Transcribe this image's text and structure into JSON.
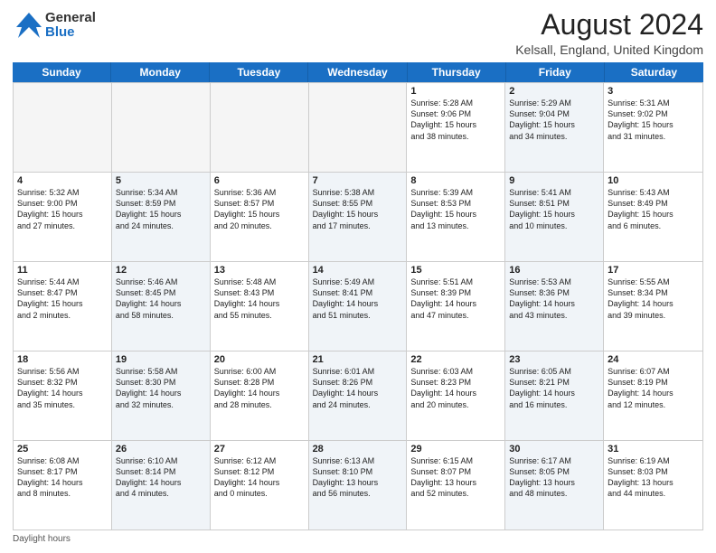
{
  "logo": {
    "general": "General",
    "blue": "Blue"
  },
  "title": "August 2024",
  "location": "Kelsall, England, United Kingdom",
  "days": [
    "Sunday",
    "Monday",
    "Tuesday",
    "Wednesday",
    "Thursday",
    "Friday",
    "Saturday"
  ],
  "rows": [
    [
      {
        "num": "",
        "lines": [],
        "shade": false,
        "empty": true
      },
      {
        "num": "",
        "lines": [],
        "shade": false,
        "empty": true
      },
      {
        "num": "",
        "lines": [],
        "shade": false,
        "empty": true
      },
      {
        "num": "",
        "lines": [],
        "shade": false,
        "empty": true
      },
      {
        "num": "1",
        "lines": [
          "Sunrise: 5:28 AM",
          "Sunset: 9:06 PM",
          "Daylight: 15 hours",
          "and 38 minutes."
        ],
        "shade": false,
        "empty": false
      },
      {
        "num": "2",
        "lines": [
          "Sunrise: 5:29 AM",
          "Sunset: 9:04 PM",
          "Daylight: 15 hours",
          "and 34 minutes."
        ],
        "shade": true,
        "empty": false
      },
      {
        "num": "3",
        "lines": [
          "Sunrise: 5:31 AM",
          "Sunset: 9:02 PM",
          "Daylight: 15 hours",
          "and 31 minutes."
        ],
        "shade": false,
        "empty": false
      }
    ],
    [
      {
        "num": "4",
        "lines": [
          "Sunrise: 5:32 AM",
          "Sunset: 9:00 PM",
          "Daylight: 15 hours",
          "and 27 minutes."
        ],
        "shade": false,
        "empty": false
      },
      {
        "num": "5",
        "lines": [
          "Sunrise: 5:34 AM",
          "Sunset: 8:59 PM",
          "Daylight: 15 hours",
          "and 24 minutes."
        ],
        "shade": true,
        "empty": false
      },
      {
        "num": "6",
        "lines": [
          "Sunrise: 5:36 AM",
          "Sunset: 8:57 PM",
          "Daylight: 15 hours",
          "and 20 minutes."
        ],
        "shade": false,
        "empty": false
      },
      {
        "num": "7",
        "lines": [
          "Sunrise: 5:38 AM",
          "Sunset: 8:55 PM",
          "Daylight: 15 hours",
          "and 17 minutes."
        ],
        "shade": true,
        "empty": false
      },
      {
        "num": "8",
        "lines": [
          "Sunrise: 5:39 AM",
          "Sunset: 8:53 PM",
          "Daylight: 15 hours",
          "and 13 minutes."
        ],
        "shade": false,
        "empty": false
      },
      {
        "num": "9",
        "lines": [
          "Sunrise: 5:41 AM",
          "Sunset: 8:51 PM",
          "Daylight: 15 hours",
          "and 10 minutes."
        ],
        "shade": true,
        "empty": false
      },
      {
        "num": "10",
        "lines": [
          "Sunrise: 5:43 AM",
          "Sunset: 8:49 PM",
          "Daylight: 15 hours",
          "and 6 minutes."
        ],
        "shade": false,
        "empty": false
      }
    ],
    [
      {
        "num": "11",
        "lines": [
          "Sunrise: 5:44 AM",
          "Sunset: 8:47 PM",
          "Daylight: 15 hours",
          "and 2 minutes."
        ],
        "shade": false,
        "empty": false
      },
      {
        "num": "12",
        "lines": [
          "Sunrise: 5:46 AM",
          "Sunset: 8:45 PM",
          "Daylight: 14 hours",
          "and 58 minutes."
        ],
        "shade": true,
        "empty": false
      },
      {
        "num": "13",
        "lines": [
          "Sunrise: 5:48 AM",
          "Sunset: 8:43 PM",
          "Daylight: 14 hours",
          "and 55 minutes."
        ],
        "shade": false,
        "empty": false
      },
      {
        "num": "14",
        "lines": [
          "Sunrise: 5:49 AM",
          "Sunset: 8:41 PM",
          "Daylight: 14 hours",
          "and 51 minutes."
        ],
        "shade": true,
        "empty": false
      },
      {
        "num": "15",
        "lines": [
          "Sunrise: 5:51 AM",
          "Sunset: 8:39 PM",
          "Daylight: 14 hours",
          "and 47 minutes."
        ],
        "shade": false,
        "empty": false
      },
      {
        "num": "16",
        "lines": [
          "Sunrise: 5:53 AM",
          "Sunset: 8:36 PM",
          "Daylight: 14 hours",
          "and 43 minutes."
        ],
        "shade": true,
        "empty": false
      },
      {
        "num": "17",
        "lines": [
          "Sunrise: 5:55 AM",
          "Sunset: 8:34 PM",
          "Daylight: 14 hours",
          "and 39 minutes."
        ],
        "shade": false,
        "empty": false
      }
    ],
    [
      {
        "num": "18",
        "lines": [
          "Sunrise: 5:56 AM",
          "Sunset: 8:32 PM",
          "Daylight: 14 hours",
          "and 35 minutes."
        ],
        "shade": false,
        "empty": false
      },
      {
        "num": "19",
        "lines": [
          "Sunrise: 5:58 AM",
          "Sunset: 8:30 PM",
          "Daylight: 14 hours",
          "and 32 minutes."
        ],
        "shade": true,
        "empty": false
      },
      {
        "num": "20",
        "lines": [
          "Sunrise: 6:00 AM",
          "Sunset: 8:28 PM",
          "Daylight: 14 hours",
          "and 28 minutes."
        ],
        "shade": false,
        "empty": false
      },
      {
        "num": "21",
        "lines": [
          "Sunrise: 6:01 AM",
          "Sunset: 8:26 PM",
          "Daylight: 14 hours",
          "and 24 minutes."
        ],
        "shade": true,
        "empty": false
      },
      {
        "num": "22",
        "lines": [
          "Sunrise: 6:03 AM",
          "Sunset: 8:23 PM",
          "Daylight: 14 hours",
          "and 20 minutes."
        ],
        "shade": false,
        "empty": false
      },
      {
        "num": "23",
        "lines": [
          "Sunrise: 6:05 AM",
          "Sunset: 8:21 PM",
          "Daylight: 14 hours",
          "and 16 minutes."
        ],
        "shade": true,
        "empty": false
      },
      {
        "num": "24",
        "lines": [
          "Sunrise: 6:07 AM",
          "Sunset: 8:19 PM",
          "Daylight: 14 hours",
          "and 12 minutes."
        ],
        "shade": false,
        "empty": false
      }
    ],
    [
      {
        "num": "25",
        "lines": [
          "Sunrise: 6:08 AM",
          "Sunset: 8:17 PM",
          "Daylight: 14 hours",
          "and 8 minutes."
        ],
        "shade": false,
        "empty": false
      },
      {
        "num": "26",
        "lines": [
          "Sunrise: 6:10 AM",
          "Sunset: 8:14 PM",
          "Daylight: 14 hours",
          "and 4 minutes."
        ],
        "shade": true,
        "empty": false
      },
      {
        "num": "27",
        "lines": [
          "Sunrise: 6:12 AM",
          "Sunset: 8:12 PM",
          "Daylight: 14 hours",
          "and 0 minutes."
        ],
        "shade": false,
        "empty": false
      },
      {
        "num": "28",
        "lines": [
          "Sunrise: 6:13 AM",
          "Sunset: 8:10 PM",
          "Daylight: 13 hours",
          "and 56 minutes."
        ],
        "shade": true,
        "empty": false
      },
      {
        "num": "29",
        "lines": [
          "Sunrise: 6:15 AM",
          "Sunset: 8:07 PM",
          "Daylight: 13 hours",
          "and 52 minutes."
        ],
        "shade": false,
        "empty": false
      },
      {
        "num": "30",
        "lines": [
          "Sunrise: 6:17 AM",
          "Sunset: 8:05 PM",
          "Daylight: 13 hours",
          "and 48 minutes."
        ],
        "shade": true,
        "empty": false
      },
      {
        "num": "31",
        "lines": [
          "Sunrise: 6:19 AM",
          "Sunset: 8:03 PM",
          "Daylight: 13 hours",
          "and 44 minutes."
        ],
        "shade": false,
        "empty": false
      }
    ]
  ],
  "footer": "Daylight hours"
}
